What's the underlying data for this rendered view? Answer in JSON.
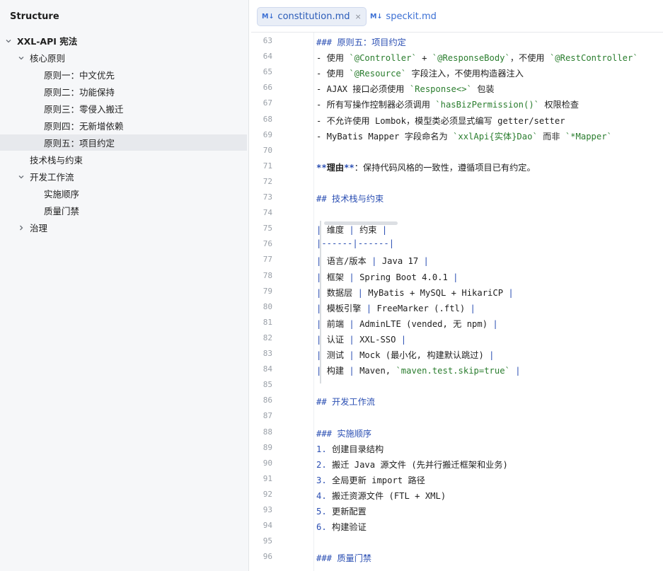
{
  "structure": {
    "title": "Structure",
    "items": [
      {
        "label": "XXL-API 宪法",
        "level": 0,
        "chevron": "down",
        "bold": true
      },
      {
        "label": "核心原则",
        "level": 1,
        "chevron": "down"
      },
      {
        "label": "原则一：中文优先",
        "level": 2,
        "chevron": "none"
      },
      {
        "label": "原则二：功能保持",
        "level": 2,
        "chevron": "none"
      },
      {
        "label": "原则三：零侵入搬迁",
        "level": 2,
        "chevron": "none"
      },
      {
        "label": "原则四：无新增依赖",
        "level": 2,
        "chevron": "none"
      },
      {
        "label": "原则五：项目约定",
        "level": 2,
        "chevron": "none",
        "selected": true
      },
      {
        "label": "技术栈与约束",
        "level": 1,
        "chevron": "none"
      },
      {
        "label": "开发工作流",
        "level": 1,
        "chevron": "down"
      },
      {
        "label": "实施顺序",
        "level": 2,
        "chevron": "none"
      },
      {
        "label": "质量门禁",
        "level": 2,
        "chevron": "none"
      },
      {
        "label": "治理",
        "level": 1,
        "chevron": "right"
      }
    ]
  },
  "tabs": [
    {
      "badge": "M↓",
      "label": "constitution.md",
      "active": true,
      "close": "×"
    },
    {
      "badge": "M↓",
      "label": "speckit.md",
      "active": false
    }
  ],
  "editor": {
    "lines": [
      {
        "n": "63",
        "segs": [
          [
            "heading",
            "### 原则五：项目约定"
          ]
        ]
      },
      {
        "n": "64",
        "segs": [
          [
            "text",
            "- 使用 "
          ],
          [
            "code",
            "`@Controller`"
          ],
          [
            "text",
            " + "
          ],
          [
            "code",
            "`@ResponseBody`"
          ],
          [
            "text",
            "，不使用 "
          ],
          [
            "code",
            "`@RestController`"
          ]
        ]
      },
      {
        "n": "65",
        "segs": [
          [
            "text",
            "- 使用 "
          ],
          [
            "code",
            "`@Resource`"
          ],
          [
            "text",
            " 字段注入，不使用构造器注入"
          ]
        ]
      },
      {
        "n": "66",
        "segs": [
          [
            "text",
            "- AJAX 接口必须使用 "
          ],
          [
            "code",
            "`Response<>`"
          ],
          [
            "text",
            " 包装"
          ]
        ]
      },
      {
        "n": "67",
        "segs": [
          [
            "text",
            "- 所有写操作控制器必须调用 "
          ],
          [
            "code",
            "`hasBizPermission()`"
          ],
          [
            "text",
            " 权限检查"
          ]
        ]
      },
      {
        "n": "68",
        "segs": [
          [
            "text",
            "- 不允许使用 Lombok，模型类必须显式编写 getter/setter"
          ]
        ]
      },
      {
        "n": "69",
        "segs": [
          [
            "text",
            "- MyBatis Mapper 字段命名为 "
          ],
          [
            "code",
            "`xxlApi{实体}Dao`"
          ],
          [
            "text",
            " 而非 "
          ],
          [
            "code",
            "`*Mapper`"
          ]
        ]
      },
      {
        "n": "70",
        "segs": []
      },
      {
        "n": "71",
        "segs": [
          [
            "boldmark",
            "**"
          ],
          [
            "bold",
            "理由"
          ],
          [
            "boldmark",
            "**"
          ],
          [
            "text",
            "：保持代码风格的一致性，遵循项目已有约定。"
          ]
        ]
      },
      {
        "n": "72",
        "segs": []
      },
      {
        "n": "73",
        "segs": [
          [
            "heading",
            "## 技术栈与约束"
          ]
        ]
      },
      {
        "n": "74",
        "segs": []
      },
      {
        "n": "75",
        "segs": [
          [
            "pipe",
            "| "
          ],
          [
            "text",
            "维度 "
          ],
          [
            "pipe",
            "| "
          ],
          [
            "text",
            "约束 "
          ],
          [
            "pipe",
            "|"
          ]
        ]
      },
      {
        "n": "76",
        "segs": [
          [
            "pipe",
            "|------|------|"
          ]
        ]
      },
      {
        "n": "77",
        "segs": [
          [
            "pipe",
            "| "
          ],
          [
            "text",
            "语言/版本 "
          ],
          [
            "pipe",
            "| "
          ],
          [
            "text",
            "Java 17 "
          ],
          [
            "pipe",
            "|"
          ]
        ]
      },
      {
        "n": "78",
        "segs": [
          [
            "pipe",
            "| "
          ],
          [
            "text",
            "框架 "
          ],
          [
            "pipe",
            "| "
          ],
          [
            "text",
            "Spring Boot 4.0.1 "
          ],
          [
            "pipe",
            "|"
          ]
        ]
      },
      {
        "n": "79",
        "segs": [
          [
            "pipe",
            "| "
          ],
          [
            "text",
            "数据层 "
          ],
          [
            "pipe",
            "| "
          ],
          [
            "text",
            "MyBatis + MySQL + HikariCP "
          ],
          [
            "pipe",
            "|"
          ]
        ]
      },
      {
        "n": "80",
        "segs": [
          [
            "pipe",
            "| "
          ],
          [
            "text",
            "模板引擎 "
          ],
          [
            "pipe",
            "| "
          ],
          [
            "text",
            "FreeMarker (.ftl) "
          ],
          [
            "pipe",
            "|"
          ]
        ]
      },
      {
        "n": "81",
        "segs": [
          [
            "pipe",
            "| "
          ],
          [
            "text",
            "前端 "
          ],
          [
            "pipe",
            "| "
          ],
          [
            "text",
            "AdminLTE (vended, 无 npm) "
          ],
          [
            "pipe",
            "|"
          ]
        ]
      },
      {
        "n": "82",
        "segs": [
          [
            "pipe",
            "| "
          ],
          [
            "text",
            "认证 "
          ],
          [
            "pipe",
            "| "
          ],
          [
            "text",
            "XXL-SSO "
          ],
          [
            "pipe",
            "|"
          ]
        ]
      },
      {
        "n": "83",
        "segs": [
          [
            "pipe",
            "| "
          ],
          [
            "text",
            "测试 "
          ],
          [
            "pipe",
            "| "
          ],
          [
            "text",
            "Mock (最小化, 构建默认跳过) "
          ],
          [
            "pipe",
            "|"
          ]
        ]
      },
      {
        "n": "84",
        "segs": [
          [
            "pipe",
            "| "
          ],
          [
            "text",
            "构建 "
          ],
          [
            "pipe",
            "| "
          ],
          [
            "text",
            "Maven, "
          ],
          [
            "code",
            "`maven.test.skip=true`"
          ],
          [
            "text",
            " "
          ],
          [
            "pipe",
            "|"
          ]
        ]
      },
      {
        "n": "85",
        "segs": []
      },
      {
        "n": "86",
        "segs": [
          [
            "heading",
            "## 开发工作流"
          ]
        ]
      },
      {
        "n": "87",
        "segs": []
      },
      {
        "n": "88",
        "segs": [
          [
            "heading",
            "### 实施顺序"
          ]
        ]
      },
      {
        "n": "89",
        "segs": [
          [
            "num",
            "1."
          ],
          [
            "text",
            " 创建目录结构"
          ]
        ]
      },
      {
        "n": "90",
        "segs": [
          [
            "num",
            "2."
          ],
          [
            "text",
            " 搬迁 Java 源文件 (先并行搬迁框架和业务)"
          ]
        ]
      },
      {
        "n": "91",
        "segs": [
          [
            "num",
            "3."
          ],
          [
            "text",
            " 全局更新 import 路径"
          ]
        ]
      },
      {
        "n": "92",
        "segs": [
          [
            "num",
            "4."
          ],
          [
            "text",
            " 搬迁资源文件 (FTL + XML)"
          ]
        ]
      },
      {
        "n": "93",
        "segs": [
          [
            "num",
            "5."
          ],
          [
            "text",
            " 更新配置"
          ]
        ]
      },
      {
        "n": "94",
        "segs": [
          [
            "num",
            "6."
          ],
          [
            "text",
            " 构建验证"
          ]
        ]
      },
      {
        "n": "95",
        "segs": []
      },
      {
        "n": "96",
        "segs": [
          [
            "heading",
            "### 质量门禁"
          ]
        ]
      }
    ]
  }
}
